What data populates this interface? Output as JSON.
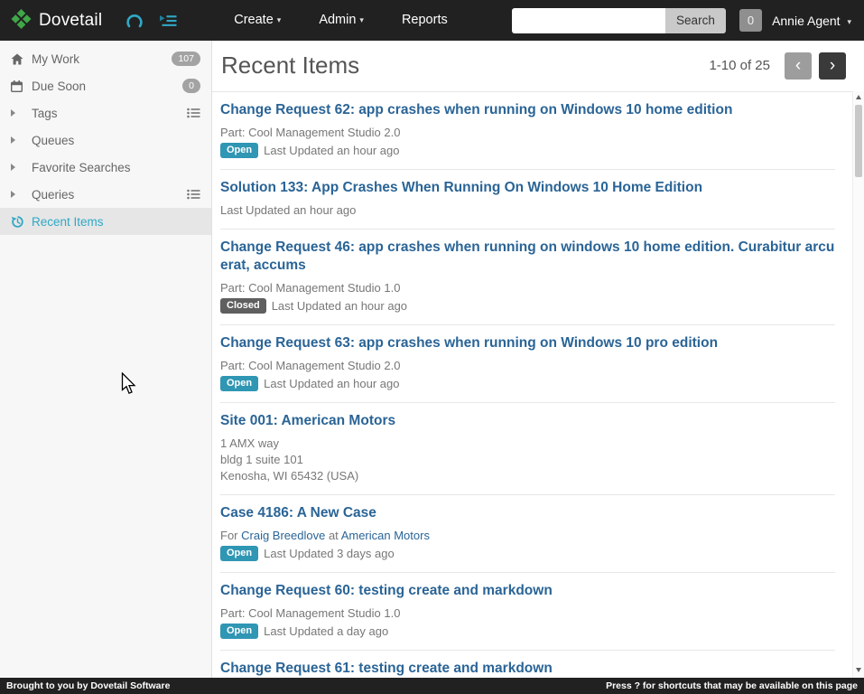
{
  "topbar": {
    "brand": "Dovetail",
    "nav": [
      {
        "label": "Create",
        "caret": true
      },
      {
        "label": "Admin",
        "caret": true
      },
      {
        "label": "Reports",
        "caret": false
      }
    ],
    "search_button": "Search",
    "counter": "0",
    "user_name": "Annie Agent"
  },
  "sidebar": {
    "items": [
      {
        "label": "My Work",
        "icon": "home",
        "badge": "107"
      },
      {
        "label": "Due Soon",
        "icon": "calendar",
        "badge": "0"
      },
      {
        "label": "Tags",
        "icon": "caret",
        "trailing_icon": "list"
      },
      {
        "label": "Queues",
        "icon": "caret"
      },
      {
        "label": "Favorite Searches",
        "icon": "caret"
      },
      {
        "label": "Queries",
        "icon": "caret",
        "trailing_icon": "list"
      },
      {
        "label": "Recent Items",
        "icon": "history",
        "selected": true
      }
    ]
  },
  "main": {
    "title": "Recent Items",
    "pagination": {
      "range": "1-10 of 25",
      "prev": "‹",
      "next": "›"
    },
    "items": [
      {
        "title": "Change Request 62: app crashes when running on Windows 10 home edition",
        "meta": [
          "Part: Cool Management Studio 2.0"
        ],
        "status": "Open",
        "status_type": "open",
        "updated": "Last Updated an hour ago"
      },
      {
        "title": "Solution 133: App Crashes When Running On Windows 10 Home Edition",
        "meta": [
          "Last Updated an hour ago"
        ]
      },
      {
        "title": "Change Request 46: app crashes when running on windows 10 home edition. Curabitur arcu erat, accums",
        "meta": [
          "Part: Cool Management Studio 1.0"
        ],
        "status": "Closed",
        "status_type": "closed",
        "updated": "Last Updated an hour ago"
      },
      {
        "title": "Change Request 63: app crashes when running on Windows 10 pro edition",
        "meta": [
          "Part: Cool Management Studio 2.0"
        ],
        "status": "Open",
        "status_type": "open",
        "updated": "Last Updated an hour ago"
      },
      {
        "title": "Site 001: American Motors",
        "meta": [
          "1 AMX way",
          "bldg 1 suite 101",
          "Kenosha, WI 65432 (USA)"
        ]
      },
      {
        "title": "Case 4186: A New Case",
        "for_line": {
          "pre": "For ",
          "link1": "Craig Breedlove",
          "mid": " at ",
          "link2": "American Motors"
        },
        "status": "Open",
        "status_type": "open",
        "updated": "Last Updated 3 days ago"
      },
      {
        "title": "Change Request 60: testing create and markdown",
        "meta": [
          "Part: Cool Management Studio 1.0"
        ],
        "status": "Open",
        "status_type": "open",
        "updated": "Last Updated a day ago"
      },
      {
        "title": "Change Request 61: testing create and markdown",
        "meta": []
      }
    ]
  },
  "footer": {
    "left": "Brought to you by Dovetail Software",
    "right": "Press ? for shortcuts that may be available on this page"
  },
  "colors": {
    "accent_teal": "#2fa8c5",
    "brand_green": "#3fa748",
    "link_blue": "#2a6496",
    "status_open": "#2f96b4",
    "status_closed": "#5f5f5f"
  }
}
